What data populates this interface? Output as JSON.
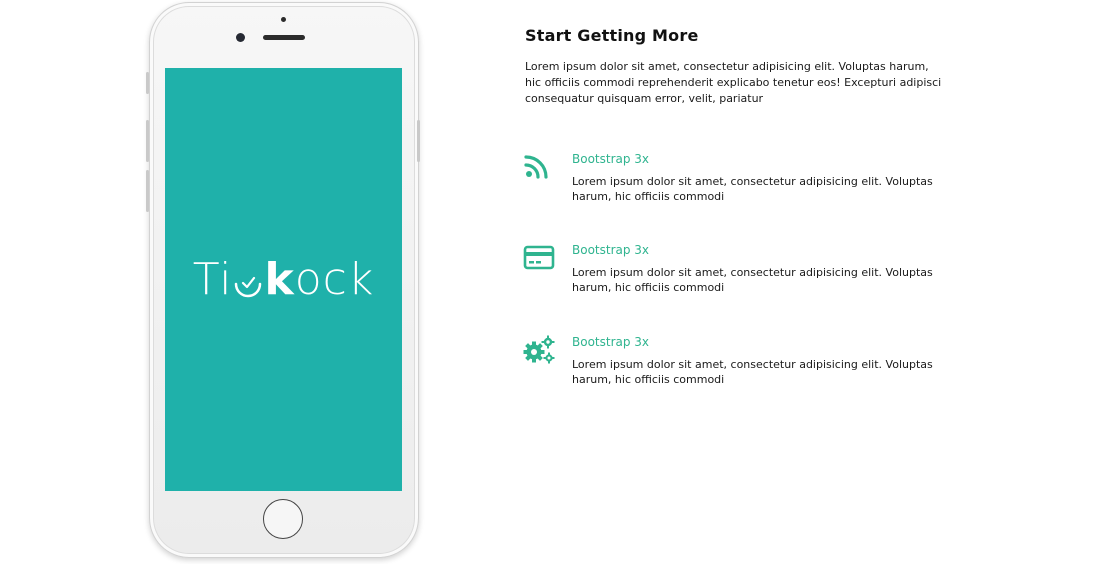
{
  "phone": {
    "logo_left": "Ti",
    "logo_k": "k",
    "logo_right": "ock",
    "screen_color": "#1fb1aa"
  },
  "section": {
    "title": "Start Getting More",
    "intro": "Lorem ipsum dolor sit amet, consectetur adipisicing elit. Voluptas harum, hic officiis commodi reprehenderit explicabo tenetur eos! Excepturi adipisci consequatur quisquam error, velit, pariatur"
  },
  "features": [
    {
      "icon": "rss-icon",
      "title": "Bootstrap 3x",
      "text": "Lorem ipsum dolor sit amet, consectetur adipisicing elit. Voluptas harum, hic officiis commodi"
    },
    {
      "icon": "credit-card-icon",
      "title": "Bootstrap 3x",
      "text": "Lorem ipsum dolor sit amet, consectetur adipisicing elit. Voluptas harum, hic officiis commodi"
    },
    {
      "icon": "gears-icon",
      "title": "Bootstrap 3x",
      "text": "Lorem ipsum dolor sit amet, consectetur adipisicing elit. Voluptas harum, hic officiis commodi"
    }
  ],
  "colors": {
    "accent": "#2fb48f",
    "text": "#1a1a1a"
  }
}
